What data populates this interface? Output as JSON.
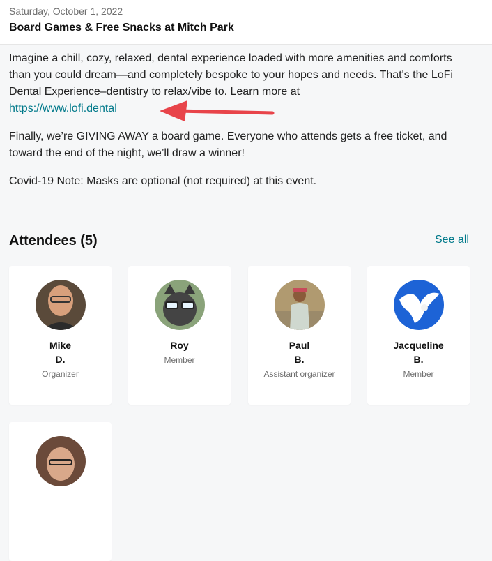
{
  "event": {
    "date": "Saturday, October 1, 2022",
    "title": "Board Games & Free Snacks at Mitch Park"
  },
  "description": {
    "p1_text": "Imagine a chill, cozy, relaxed, dental experience loaded with more amenities and comforts than you could dream—and completely bespoke to your hopes and needs. That's the LoFi Dental Experience–dentistry to relax/vibe to. Learn more at",
    "p1_link": "https://www.lofi.dental",
    "p2": "Finally, we’re GIVING AWAY a board game. Everyone who attends gets a free ticket, and toward the end of the night, we’ll draw a winner!",
    "p3": "Covid-19 Note: Masks are optional (not required) at this event."
  },
  "annotation": {
    "arrow_color": "#e8444a"
  },
  "attendees": {
    "title": "Attendees (5)",
    "see_all": "See all",
    "list": [
      {
        "first": "Mike",
        "last": "D.",
        "role": "Organizer"
      },
      {
        "first": "Roy",
        "last": "",
        "role": "Member"
      },
      {
        "first": "Paul",
        "last": "B.",
        "role": "Assistant organizer"
      },
      {
        "first": "Jacqueline",
        "last": "B.",
        "role": "Member"
      },
      {
        "first": "",
        "last": "",
        "role": ""
      }
    ]
  },
  "colors": {
    "link": "#00798a",
    "background": "#f6f7f8",
    "card": "#ffffff"
  }
}
